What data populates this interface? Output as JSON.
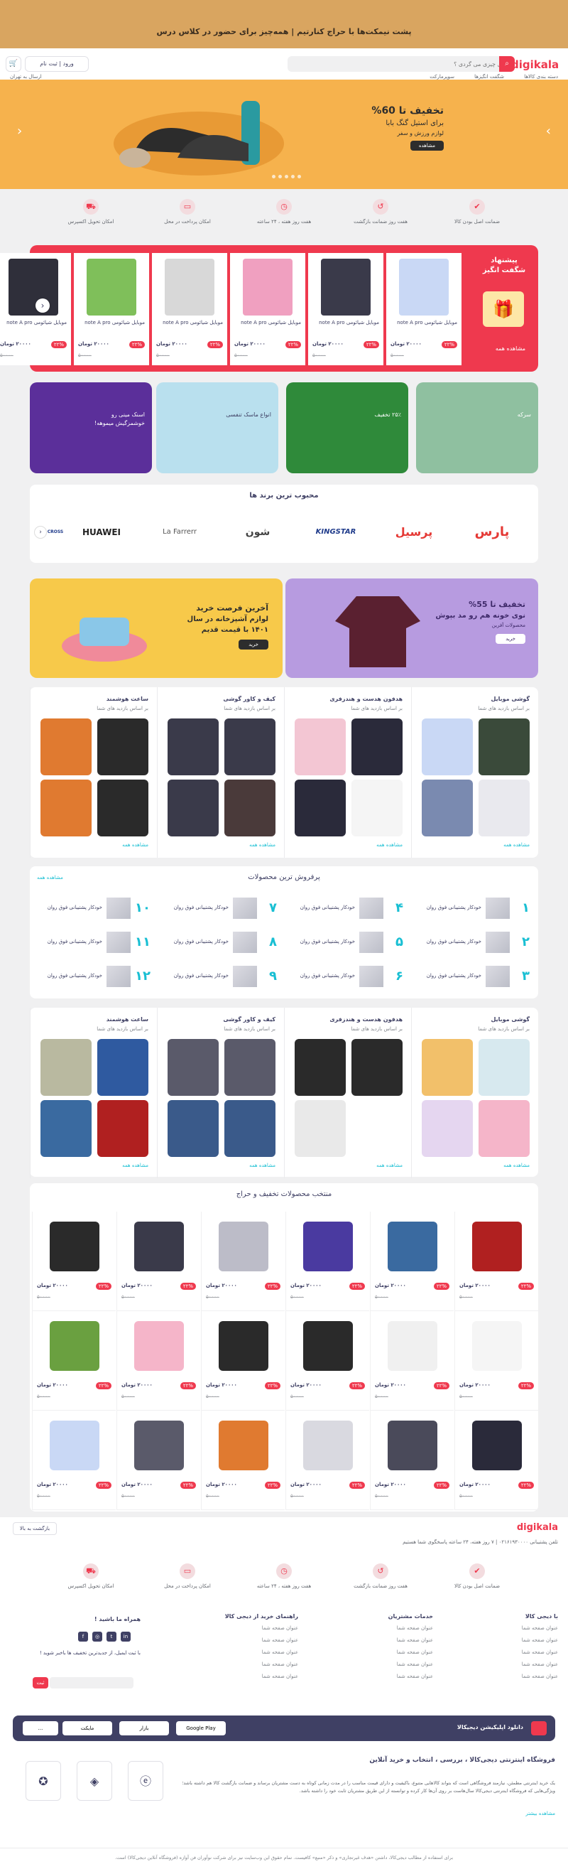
{
  "top_banner": {
    "text": "پشت نیمکت‌ها با حراج کنارتیم | همه‌چیز برای حضور در کلاس درس"
  },
  "header": {
    "logo": "digikala",
    "search_placeholder": "دنبال چیزی می گردی ؟",
    "login_label": "ورود | ثبت نام",
    "nav": [
      "دسته بندی کالاها",
      "شگفت انگیزها",
      "سوپرمارکت",
      "ارسال به تهران"
    ]
  },
  "hero": {
    "line1": "تخفیف تا 60%",
    "line2": "برای استیل گنگ بابا",
    "line3": "لوازم ورزش و سفر",
    "button": "مشاهده"
  },
  "services": [
    "ضمانت اصل بودن کالا",
    "هفت روز ضمانت بازگشت",
    "هفت روز هفته ، ۲۴ ساعته",
    "امکان پرداخت در محل",
    "امکان تحویل اکسپرس"
  ],
  "amazing": {
    "title": "پیشنهاد شگفت انگیز",
    "see_all": "مشاهده همه",
    "items": [
      {
        "name": "موبایل شیائومی note A pro",
        "discount": "۲۲%",
        "price": "۲۰۰۰۰ تومان",
        "old": "۵۰۰۰۰",
        "color": "#c9d8f5"
      },
      {
        "name": "موبایل شیائومی note A pro",
        "discount": "۲۲%",
        "price": "۲۰۰۰۰ تومان",
        "old": "۵۰۰۰۰",
        "color": "#3a3a4a"
      },
      {
        "name": "موبایل شیائومی note A pro",
        "discount": "۲۲%",
        "price": "۲۰۰۰۰ تومان",
        "old": "۵۰۰۰۰",
        "color": "#f0a0c0"
      },
      {
        "name": "موبایل شیائومی note A pro",
        "discount": "۲۲%",
        "price": "۲۰۰۰۰ تومان",
        "old": "۵۰۰۰۰",
        "color": "#d8d8d8"
      },
      {
        "name": "موبایل شیائومی note A pro",
        "discount": "۲۲%",
        "price": "۲۰۰۰۰ تومان",
        "old": "۵۰۰۰۰",
        "color": "#7fbf5a"
      },
      {
        "name": "موبایل شیائومی note A pro",
        "discount": "۲۲%",
        "price": "۲۰۰۰۰ تومان",
        "old": "۵۰۰۰۰",
        "color": "#2f2f3a"
      }
    ]
  },
  "promos": [
    {
      "text": "سرکه",
      "color": "#8fc0a0"
    },
    {
      "text": "۲۵٪ تخفیف",
      "color": "#2f8a3a"
    },
    {
      "text": "انواع ماسک تنفسی",
      "color": "#b9e0ee"
    },
    {
      "text": "اسنک مینی رو خوشمزگیش میموهه!",
      "color": "#5b2f9a"
    }
  ],
  "brands": {
    "title": "محبوب ترین برند ها",
    "items": [
      "پارس",
      "پرسیل",
      "KINGSTAR",
      "شون",
      "La Farrerr",
      "HUAWEI",
      "CROSS"
    ]
  },
  "banner_spring": {
    "line1": "تخفیف تا 55%",
    "line2": "نوی خونه هم رو مد بپوش",
    "line3": "محصولات آفرین",
    "button": "خرید"
  },
  "banner_last": {
    "line1": "آخرین فرصت خرید",
    "line2": "لوازم آشپزخانه در سال",
    "line3": "۱۴۰۱ با قیمت قدیم",
    "button": "خرید"
  },
  "categories": [
    {
      "title": "گوشی موبایل",
      "sub": "بر اساس بازدید های شما",
      "more": "مشاهده همه"
    },
    {
      "title": "هدفون هدست و هندزفری",
      "sub": "بر اساس بازدید های شما",
      "more": "مشاهده همه"
    },
    {
      "title": "کیف و کاور گوشی",
      "sub": "بر اساس بازدید های شما",
      "more": "مشاهده همه"
    },
    {
      "title": "ساعت هوشمند",
      "sub": "بر اساس بازدید های شما",
      "more": "مشاهده همه"
    }
  ],
  "bestsellers": {
    "title": "پرفروش ترین محصولات",
    "see_all": "مشاهده همه",
    "items": [
      {
        "num": "۱",
        "name": "خودکار پشتیبانی فوق روان"
      },
      {
        "num": "۲",
        "name": "خودکار پشتیبانی فوق روان"
      },
      {
        "num": "۳",
        "name": "خودکار پشتیبانی فوق روان"
      },
      {
        "num": "۴",
        "name": "خودکار پشتیبانی فوق روان"
      },
      {
        "num": "۵",
        "name": "خودکار پشتیبانی فوق روان"
      },
      {
        "num": "۶",
        "name": "خودکار پشتیبانی فوق روان"
      },
      {
        "num": "۷",
        "name": "خودکار پشتیبانی فوق روان"
      },
      {
        "num": "۸",
        "name": "خودکار پشتیبانی فوق روان"
      },
      {
        "num": "۹",
        "name": "خودکار پشتیبانی فوق روان"
      },
      {
        "num": "۱۰",
        "name": "خودکار پشتیبانی فوق روان"
      },
      {
        "num": "۱۱",
        "name": "خودکار پشتیبانی فوق روان"
      },
      {
        "num": "۱۲",
        "name": "خودکار پشتیبانی فوق روان"
      }
    ]
  },
  "discount": {
    "title": "منتخب محصولات تخفیف و حراج",
    "price": "۲۰۰۰۰ تومان",
    "discount": "۲۲%",
    "old": "۵۰۰۰۰"
  },
  "footer": {
    "logo": "digikala",
    "contact": "تلفن پشتیبانی ۰۲۱۶۱۹۳۰۰۰۰ | ۷ روز هفته، ۲۴ ساعته پاسخگوی شما هستیم",
    "back_to_top": "بازگشت به بالا",
    "columns": [
      {
        "title": "با دیجی کالا",
        "links": [
          "عنوان صفحه شما",
          "عنوان صفحه شما",
          "عنوان صفحه شما",
          "عنوان صفحه شما",
          "عنوان صفحه شما"
        ]
      },
      {
        "title": "خدمات مشتریان",
        "links": [
          "عنوان صفحه شما",
          "عنوان صفحه شما",
          "عنوان صفحه شما",
          "عنوان صفحه شما",
          "عنوان صفحه شما"
        ]
      },
      {
        "title": "راهنمای خرید از دیجی کالا",
        "links": [
          "عنوان صفحه شما",
          "عنوان صفحه شما",
          "عنوان صفحه شما",
          "عنوان صفحه شما",
          "عنوان صفحه شما"
        ]
      }
    ],
    "social_title": "همراه ما باشید !",
    "newsletter": "با ثبت ایمیل، از جدیدترین تخفیف ها باخبر شوید !",
    "newsletter_button": "ثبت",
    "app_title": "دانلود اپلیکیشن دیجیکالا",
    "stores": [
      "Google Play",
      "بازار",
      "مایکت",
      "..."
    ],
    "about_title": "فروشگاه اینترنتی دیجی‌کالا ، بررسی ، انتخاب و خرید آنلاین",
    "about_text": "یک خرید اینترنتی مطمئن، نیازمند فروشگاهی است که بتواند کالاهایی متنوع، باکیفیت و دارای قیمت مناسب را در مدت زمانی کوتاه به دست مشتریان برساند و ضمانت بازگشت کالا هم داشته باشد؛ ویژگی‌هایی که فروشگاه اینترنتی دیجی‌کالا سال‌هاست بر روی آن‌ها کار کرده و توانسته از این طریق مشتریان ثابت خود را داشته باشد.",
    "about_more": "مشاهده بیشتر",
    "copyright": "برای استفاده از مطالب دیجی‌کالا، داشتن «هدف غیرتجاری» و ذکر «منبع» کافیست. تمام حقوق این وب‌سایت نیز برای شرکت نوآوران فن آوازه (فروشگاه آنلاین دیجی‌کالا) است."
  }
}
